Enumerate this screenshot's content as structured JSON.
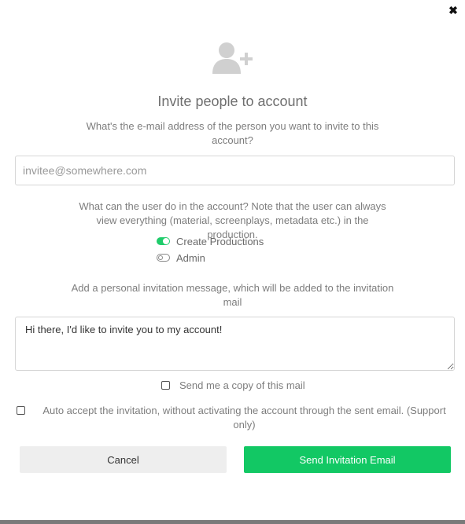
{
  "dialog": {
    "title": "Invite people to account",
    "email_question": "What's the e-mail address of the person you want to invite to this account?",
    "email_placeholder": "invitee@somewhere.com",
    "permissions_question": "What can the user do in the account? Note that the user can always view everything (material, screenplays, metadata etc.) in the production.",
    "permissions": [
      {
        "label": "Create Productions",
        "enabled": true
      },
      {
        "label": "Admin",
        "enabled": false
      }
    ],
    "message_prompt": "Add a personal invitation message, which will be added to the invitation mail",
    "message_value": "Hi there, I'd like to invite you to my account!",
    "copy_label": "Send me a copy of this mail",
    "auto_accept_label": "Auto accept the invitation, without activating the account through the sent email. (Support only)",
    "cancel_label": "Cancel",
    "send_label": "Send Invitation Email",
    "close_glyph": "✖"
  },
  "colors": {
    "accent": "#12c864",
    "icon": "#d0d0d0"
  },
  "icons": {
    "header": "add-user-icon",
    "close": "close-icon"
  }
}
